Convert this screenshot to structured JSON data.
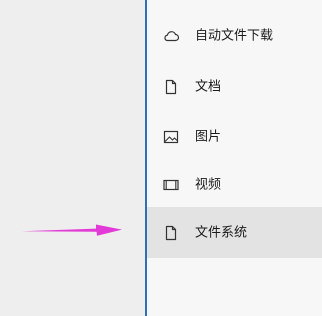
{
  "menu": {
    "items": [
      {
        "label": "自动文件下载",
        "icon": "cloud-icon",
        "selected": false
      },
      {
        "label": "文档",
        "icon": "document-icon",
        "selected": false
      },
      {
        "label": "图片",
        "icon": "image-icon",
        "selected": false
      },
      {
        "label": "视频",
        "icon": "film-icon",
        "selected": false
      },
      {
        "label": "文件系统",
        "icon": "document-icon",
        "selected": true
      }
    ]
  },
  "annotation": {
    "arrow_color": "#e23ad6",
    "points_to": "文件系统"
  },
  "colors": {
    "divider": "#2f6fb3",
    "selected_bg": "#e3e3e3"
  }
}
